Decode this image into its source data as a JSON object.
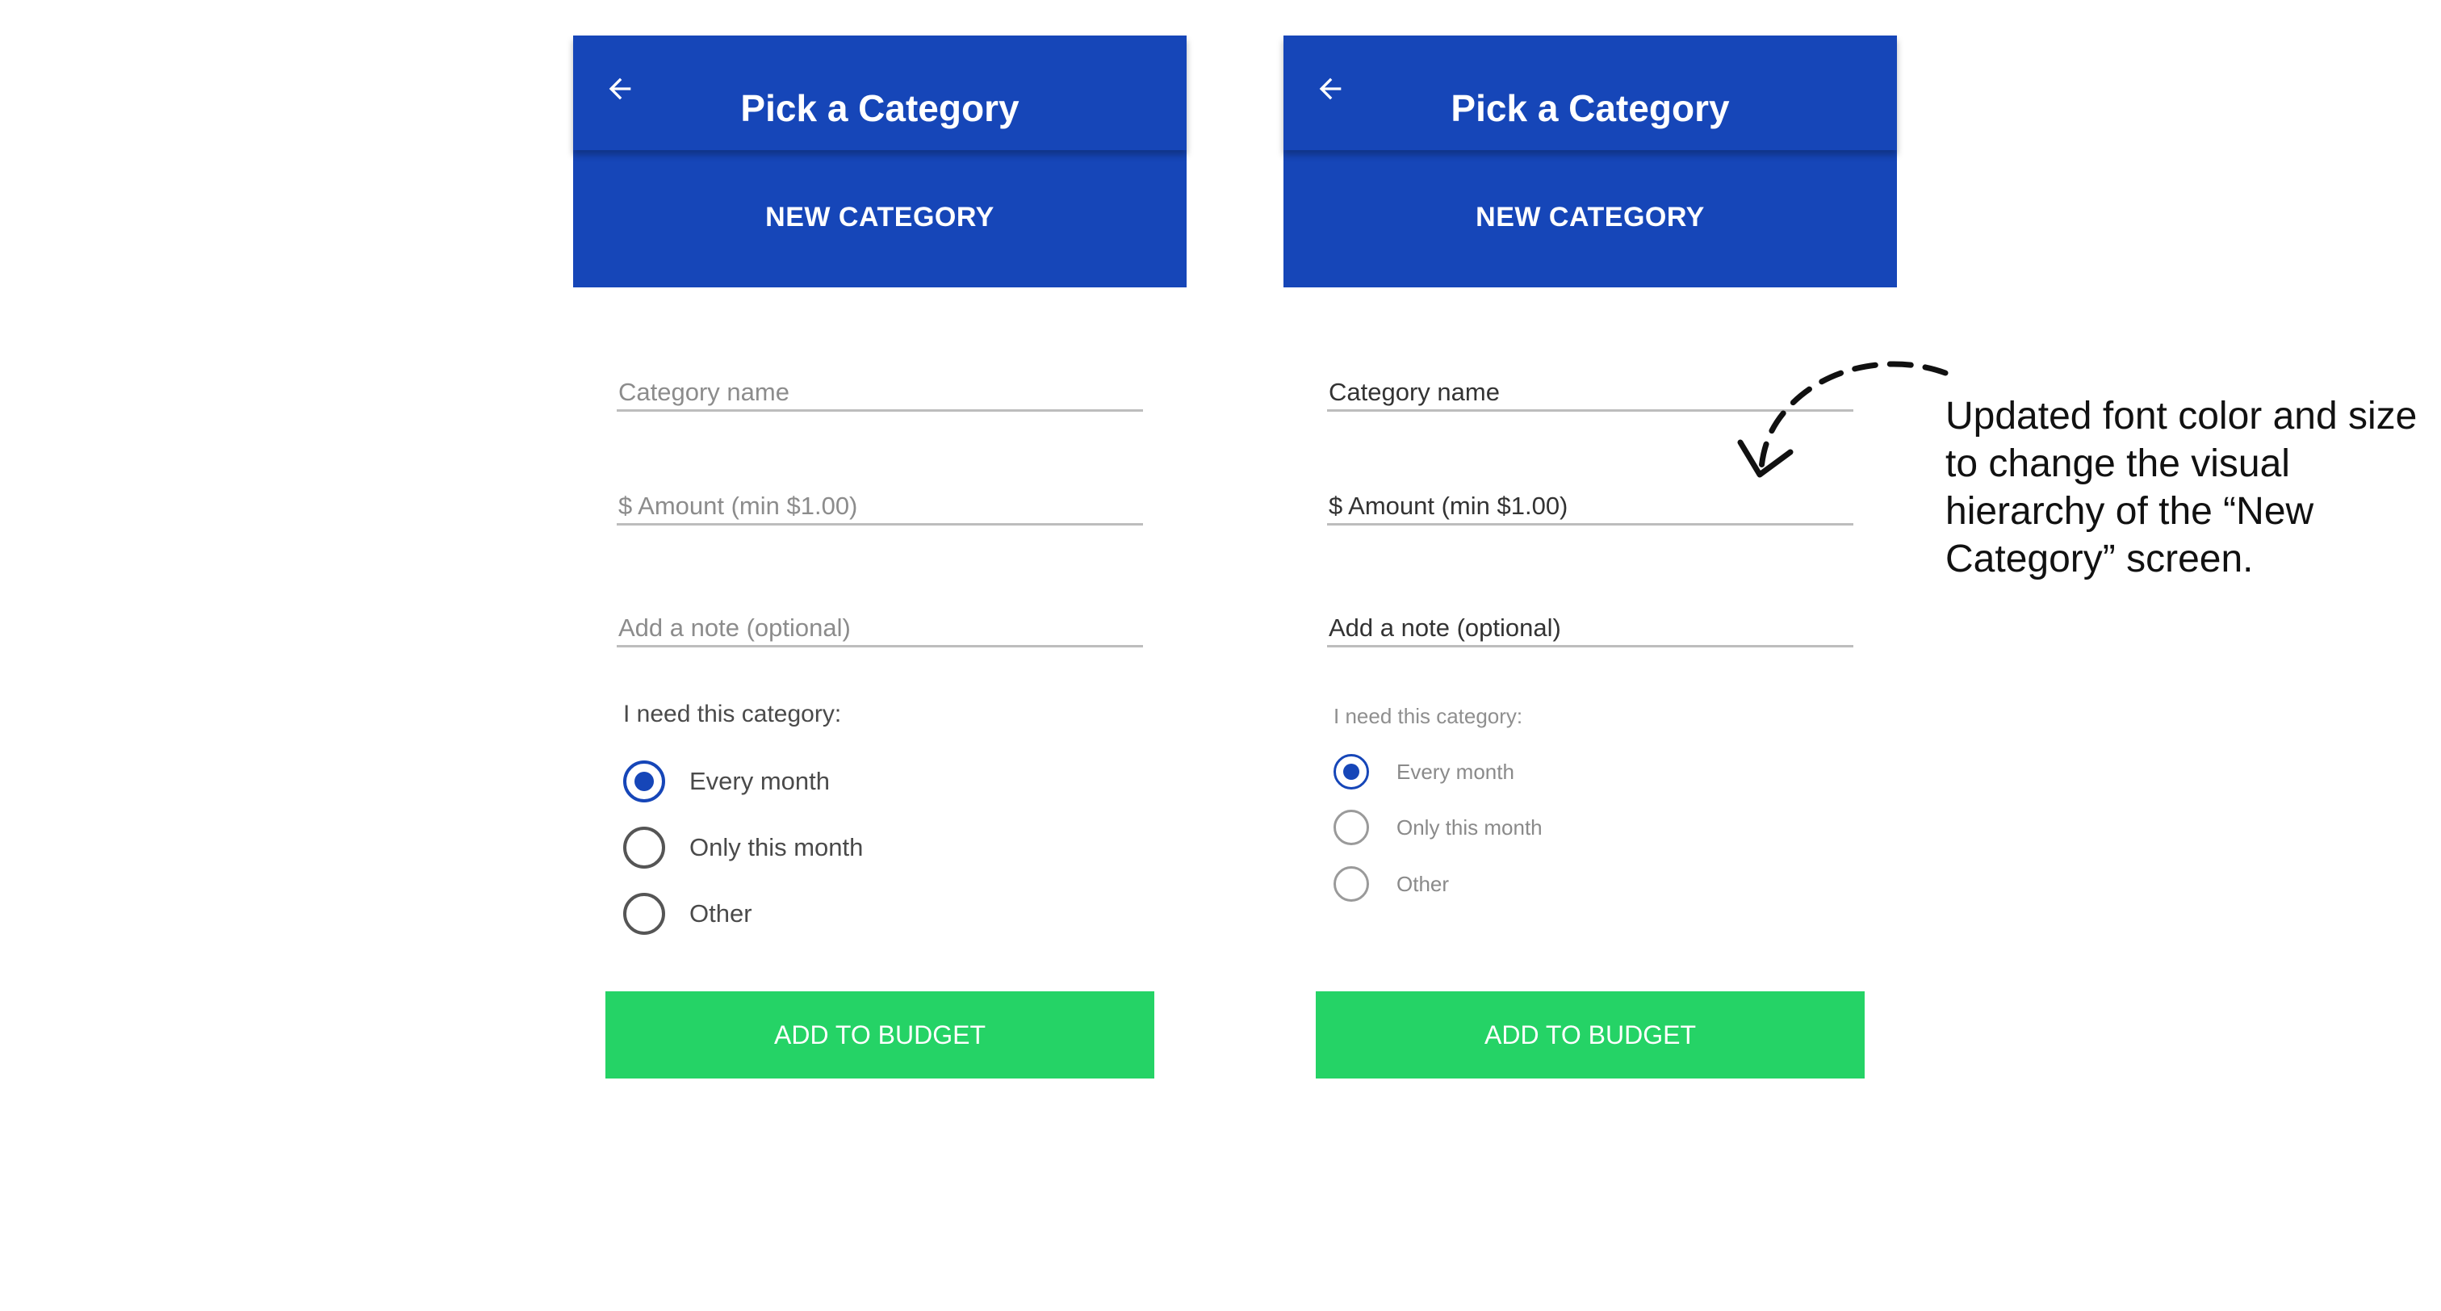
{
  "screens": [
    {
      "id": "before",
      "header": {
        "title": "Pick a Category",
        "back_icon": "arrow-left-icon"
      },
      "subheader": {
        "label": "NEW CATEGORY"
      },
      "fields": [
        {
          "placeholder": "Category name",
          "value": ""
        },
        {
          "placeholder": "$ Amount (min $1.00)",
          "value": ""
        },
        {
          "placeholder": "Add a note (optional)",
          "value": ""
        }
      ],
      "frequency": {
        "label": "I need this category:",
        "options": [
          {
            "label": "Every month",
            "selected": true
          },
          {
            "label": "Only this month",
            "selected": false
          },
          {
            "label": "Other",
            "selected": false
          }
        ]
      },
      "cta": {
        "label": "ADD TO BUDGET"
      }
    },
    {
      "id": "after",
      "header": {
        "title": "Pick a Category",
        "back_icon": "arrow-left-icon"
      },
      "subheader": {
        "label": "NEW CATEGORY"
      },
      "fields": [
        {
          "placeholder": "Category name",
          "value": ""
        },
        {
          "placeholder": "$ Amount (min $1.00)",
          "value": ""
        },
        {
          "placeholder": "Add a note (optional)",
          "value": ""
        }
      ],
      "frequency": {
        "label": "I need this category:",
        "options": [
          {
            "label": "Every month",
            "selected": true
          },
          {
            "label": "Only this month",
            "selected": false
          },
          {
            "label": "Other",
            "selected": false
          }
        ]
      },
      "cta": {
        "label": "ADD TO BUDGET"
      }
    }
  ],
  "annotation": {
    "text": "Updated font color and size to change the visual hierarchy of the “New Category” screen.",
    "arrow_icon": "dashed-curved-arrow-icon"
  },
  "colors": {
    "primary_blue": "#1646b8",
    "cta_green": "#25d366",
    "text_dark": "#333333",
    "text_muted": "#8c8c8c"
  }
}
